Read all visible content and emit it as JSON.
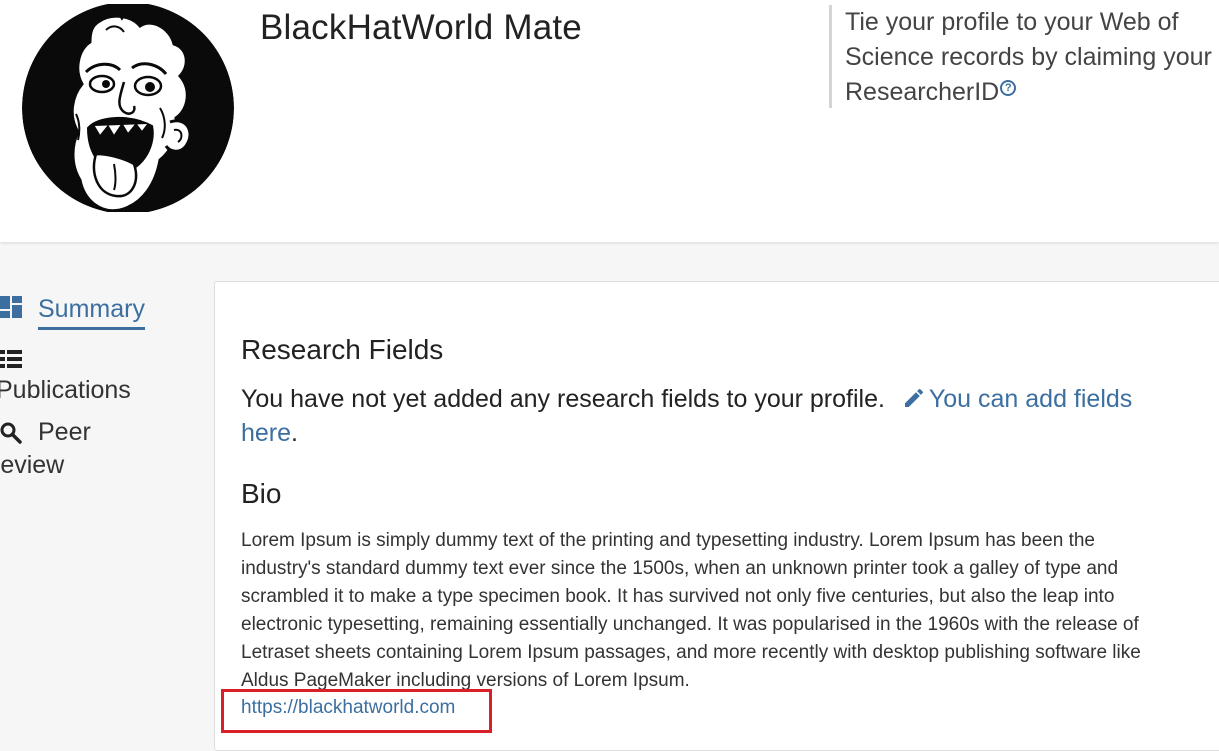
{
  "header": {
    "name": "BlackHatWorld Mate",
    "researcher_prompt": "Tie your profile to your Web of Science records by claiming your ResearcherID",
    "help_icon": "question-circle-icon"
  },
  "sidebar": {
    "items": [
      {
        "label": "Summary",
        "icon": "dashboard-icon",
        "active": true
      },
      {
        "label": "Publications",
        "icon": "list-icon",
        "active": false
      },
      {
        "label": "Peer review",
        "icon": "search-icon",
        "active": false
      }
    ]
  },
  "main": {
    "research_fields": {
      "heading": "Research Fields",
      "empty_text": "You have not yet added any research fields to your profile.",
      "add_link": "You can add fields here",
      "add_link_icon": "pencil-icon",
      "trailing": "."
    },
    "bio": {
      "heading": "Bio",
      "text": "Lorem Ipsum is simply dummy text of the printing and typesetting industry. Lorem Ipsum has been the industry's standard dummy text ever since the 1500s, when an unknown printer took a galley of type and scrambled it to make a type specimen book. It has survived not only five centuries, but also the leap into electronic typesetting, remaining essentially unchanged. It was popularised in the 1960s with the release of Letraset sheets containing Lorem Ipsum passages, and more recently with desktop publishing software like Aldus PageMaker including versions of Lorem Ipsum.",
      "link": "https://blackhatworld.com",
      "highlight_color": "#d91f2a"
    }
  },
  "colors": {
    "link": "#3c6fa0",
    "highlight": "#d91f2a"
  }
}
